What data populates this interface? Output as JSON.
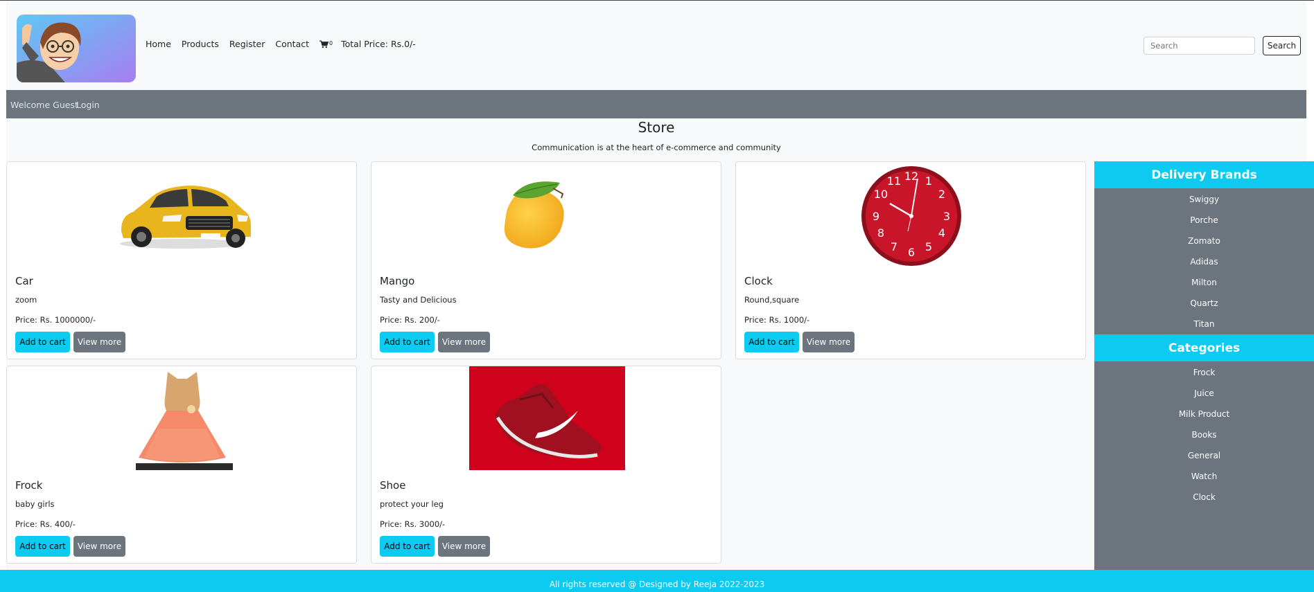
{
  "nav": {
    "home": "Home",
    "products": "Products",
    "register": "Register",
    "contact": "Contact",
    "cart_count": "0",
    "total_price": "Total Price: Rs.0/-",
    "search_placeholder": "Search",
    "search_button": "Search"
  },
  "secondary": {
    "welcome": "Welcome Guest",
    "login": "Login"
  },
  "store": {
    "title": "Store",
    "subtitle": "Communication is at the heart of e-commerce and community"
  },
  "products": [
    {
      "title": "Car",
      "desc": "zoom",
      "price": "Price: Rs. 1000000/-",
      "add": "Add to cart",
      "more": "View more"
    },
    {
      "title": "Mango",
      "desc": "Tasty and Delicious",
      "price": "Price: Rs. 200/-",
      "add": "Add to cart",
      "more": "View more"
    },
    {
      "title": "Clock",
      "desc": "Round,square",
      "price": "Price: Rs. 1000/-",
      "add": "Add to cart",
      "more": "View more"
    },
    {
      "title": "Frock",
      "desc": "baby girls",
      "price": "Price: Rs. 400/-",
      "add": "Add to cart",
      "more": "View more"
    },
    {
      "title": "Shoe",
      "desc": "protect your leg",
      "price": "Price: Rs. 3000/-",
      "add": "Add to cart",
      "more": "View more"
    }
  ],
  "sidebar": {
    "brands_title": "Delivery Brands",
    "brands": [
      "Swiggy",
      "Porche",
      "Zomato",
      "Adidas",
      "Milton",
      "Quartz",
      "Titan"
    ],
    "categories_title": "Categories",
    "categories": [
      "Frock",
      "Juice",
      "Milk Product",
      "Books",
      "General",
      "Watch",
      "Clock"
    ]
  },
  "footer": {
    "text": "All rights reserved @ Designed by Reeja 2022-2023"
  },
  "colors": {
    "accent": "#0dcaf0",
    "secondary": "#6c757d",
    "light": "#f8f9fa"
  }
}
